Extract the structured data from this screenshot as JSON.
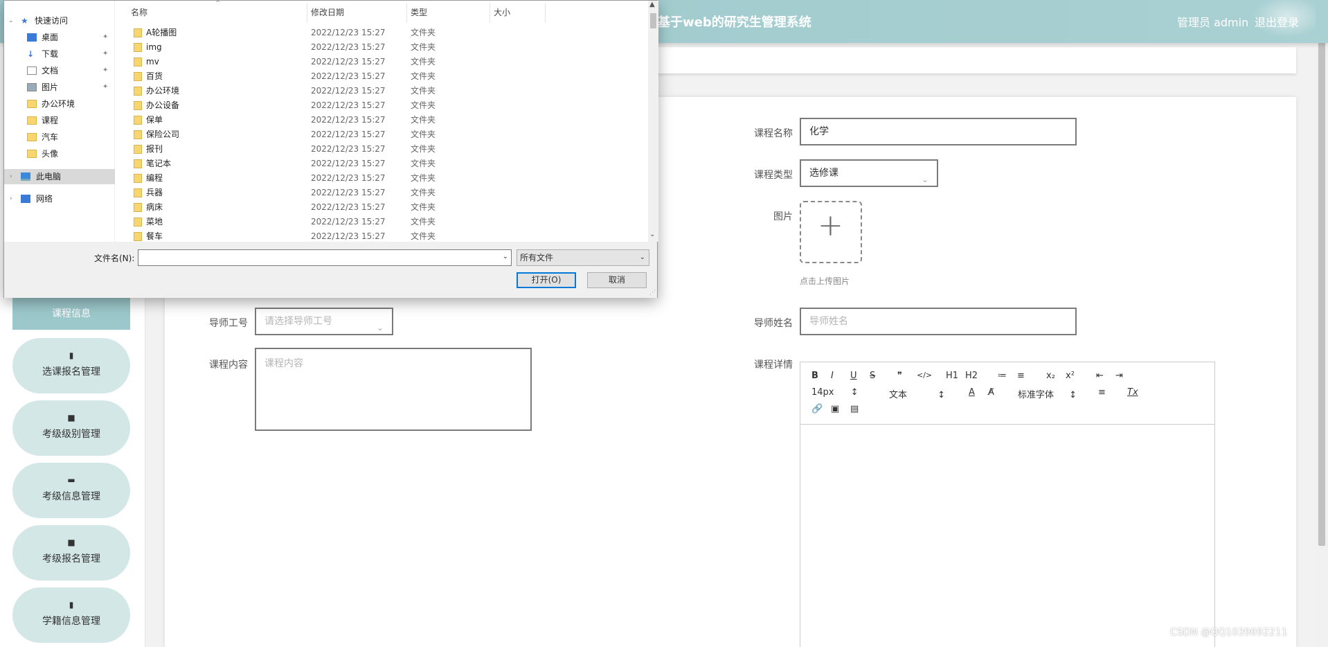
{
  "header": {
    "title": "基于web的研究生管理系统",
    "admin": "管理员 admin",
    "logout": "退出登录"
  },
  "sidebar": {
    "active": "课程信息",
    "items": [
      {
        "label": "选课报名管理",
        "icon": "clipboard-icon"
      },
      {
        "label": "考级级别管理",
        "icon": "grid-icon"
      },
      {
        "label": "考级信息管理",
        "icon": "chat-icon"
      },
      {
        "label": "考级报名管理",
        "icon": "grid-icon"
      },
      {
        "label": "学籍信息管理",
        "icon": "clipboard-icon"
      }
    ]
  },
  "form": {
    "course_name_label": "课程名称",
    "course_name_value": "化学",
    "course_type_label": "课程类型",
    "course_type_value": "选修课",
    "image_label": "图片",
    "upload_hint": "点击上传图片",
    "teacher_id_label": "导师工号",
    "teacher_id_placeholder": "请选择导师工号",
    "teacher_name_label": "导师姓名",
    "teacher_name_placeholder": "导师姓名",
    "content_label": "课程内容",
    "content_placeholder": "课程内容",
    "detail_label": "课程详情"
  },
  "editor": {
    "font_size": "14px",
    "text_style": "文本",
    "font_family": "标准字体",
    "tools": [
      "B",
      "I",
      "U",
      "S",
      "❞",
      "</>",
      "H1",
      "H2",
      "≔",
      "≡",
      "x₂",
      "x²",
      "⇤",
      "⇥",
      "A",
      "A̸",
      "≡",
      "Tx",
      "🔗",
      "▣",
      "▤"
    ]
  },
  "dialog": {
    "nav": [
      {
        "label": "快速访问"
      },
      {
        "label": "桌面"
      },
      {
        "label": "下载"
      },
      {
        "label": "文档"
      },
      {
        "label": "图片"
      },
      {
        "label": "办公环境"
      },
      {
        "label": "课程"
      },
      {
        "label": "汽车"
      },
      {
        "label": "头像"
      },
      {
        "label": "此电脑"
      },
      {
        "label": "网络"
      }
    ],
    "columns": [
      "名称",
      "修改日期",
      "类型",
      "大小"
    ],
    "files": [
      {
        "name": "A轮播图",
        "date": "2022/12/23 15:27",
        "type": "文件夹"
      },
      {
        "name": "img",
        "date": "2022/12/23 15:27",
        "type": "文件夹"
      },
      {
        "name": "mv",
        "date": "2022/12/23 15:27",
        "type": "文件夹"
      },
      {
        "name": "百货",
        "date": "2022/12/23 15:27",
        "type": "文件夹"
      },
      {
        "name": "办公环境",
        "date": "2022/12/23 15:27",
        "type": "文件夹"
      },
      {
        "name": "办公设备",
        "date": "2022/12/23 15:27",
        "type": "文件夹"
      },
      {
        "name": "保单",
        "date": "2022/12/23 15:27",
        "type": "文件夹"
      },
      {
        "name": "保险公司",
        "date": "2022/12/23 15:27",
        "type": "文件夹"
      },
      {
        "name": "报刊",
        "date": "2022/12/23 15:27",
        "type": "文件夹"
      },
      {
        "name": "笔记本",
        "date": "2022/12/23 15:27",
        "type": "文件夹"
      },
      {
        "name": "编程",
        "date": "2022/12/23 15:27",
        "type": "文件夹"
      },
      {
        "name": "兵器",
        "date": "2022/12/23 15:27",
        "type": "文件夹"
      },
      {
        "name": "病床",
        "date": "2022/12/23 15:27",
        "type": "文件夹"
      },
      {
        "name": "菜地",
        "date": "2022/12/23 15:27",
        "type": "文件夹"
      },
      {
        "name": "餐车",
        "date": "2022/12/23 15:27",
        "type": "文件夹"
      }
    ],
    "filename_label": "文件名(N):",
    "filetype": "所有文件",
    "open": "打开(O)",
    "cancel": "取消"
  },
  "watermark": "CSDN @QQ1039692211"
}
